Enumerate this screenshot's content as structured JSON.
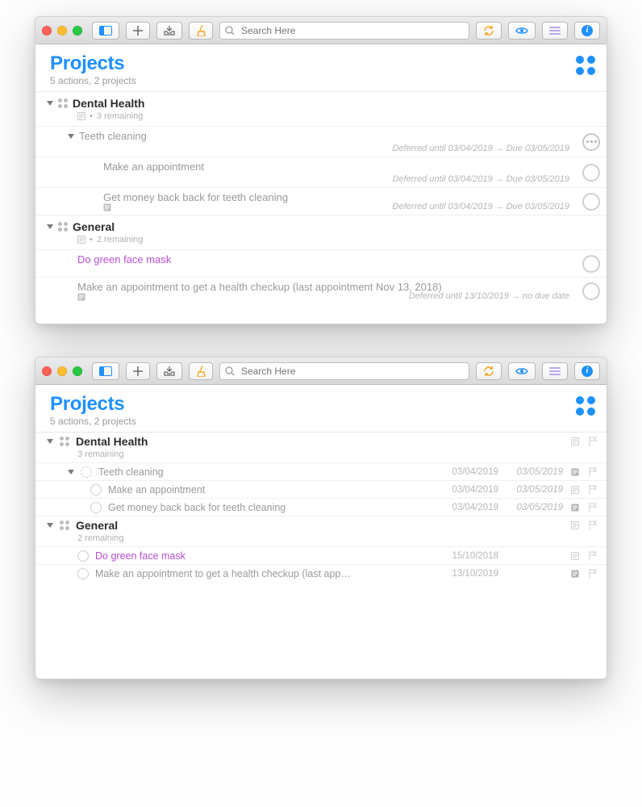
{
  "toolbar": {
    "search_placeholder": "Search Here",
    "info_glyph": "i"
  },
  "header": {
    "title": "Projects",
    "subtitle": "5 actions, 2 projects"
  },
  "win1": {
    "projects": [
      {
        "name": "Dental Health",
        "meta_prefix": "•",
        "meta": "3 remaining",
        "group": {
          "title": "Teeth cleaning",
          "defer_label": "Deferred until 03/04/2019",
          "due_label": "Due 03/05/2019"
        },
        "tasks": [
          {
            "title": "Make an appointment",
            "defer_label": "Deferred until 03/04/2019",
            "due_label": "Due 03/05/2019"
          },
          {
            "title": "Get money back back for teeth cleaning",
            "defer_label": "Deferred until 03/04/2019",
            "due_label": "Due 03/05/2019"
          }
        ]
      },
      {
        "name": "General",
        "meta_prefix": "•",
        "meta": "2 remaining",
        "tasks": [
          {
            "title": "Do green face mask",
            "purple": true
          },
          {
            "title": "Make an appointment to get a health checkup (last appointment Nov 13, 2018)",
            "defer_label": "Deferred until 13/10/2019",
            "due_label": "no due date"
          }
        ]
      }
    ]
  },
  "win2": {
    "projects": [
      {
        "name": "Dental Health",
        "meta": "3 remaining",
        "rows": [
          {
            "title": "Teeth cleaning",
            "d1": "03/04/2019",
            "d2": "03/05/2019",
            "dotted": true,
            "note_filled": true,
            "disclosure": true
          },
          {
            "title": "Make an appointment",
            "d1": "03/04/2019",
            "d2": "03/05/2019",
            "indent": true
          },
          {
            "title": "Get money back back for teeth cleaning",
            "d1": "03/04/2019",
            "d2": "03/05/2019",
            "indent": true,
            "note_filled": true
          }
        ]
      },
      {
        "name": "General",
        "meta": "2 remaining",
        "rows": [
          {
            "title": "Do green face mask",
            "d1": "15/10/2018",
            "d2": "",
            "purple": true
          },
          {
            "title": "Make an appointment to get a health checkup (last app…",
            "d1": "13/10/2019",
            "d2": "",
            "note_filled": true
          }
        ]
      }
    ]
  }
}
